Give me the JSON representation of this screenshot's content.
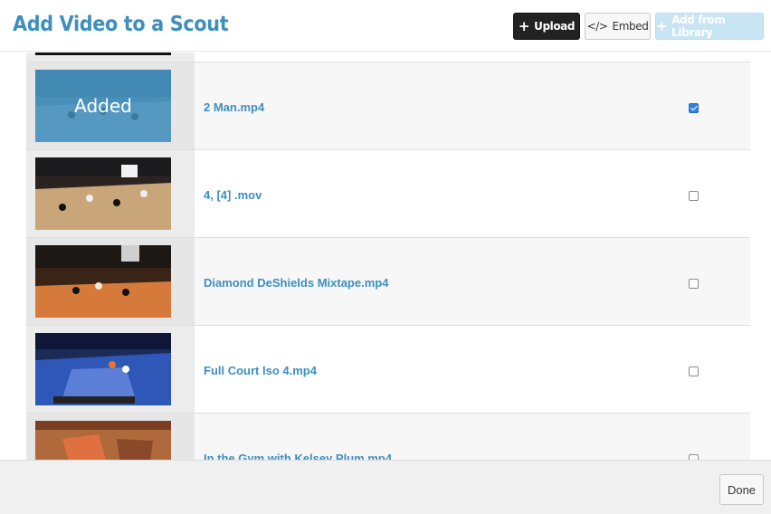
{
  "header": {
    "title": "Add Video to a Scout",
    "upload_label": "Upload",
    "embed_label": "Embed",
    "library_label": "Add from Library"
  },
  "videos": [
    {
      "name": "2 Man.mp4",
      "checked": true,
      "overlay": "Added"
    },
    {
      "name": "4, [4] .mov",
      "checked": false
    },
    {
      "name": "Diamond DeShields Mixtape.mp4",
      "checked": false
    },
    {
      "name": "Full Court Iso 4.mp4",
      "checked": false
    },
    {
      "name": "In the Gym with Kelsey Plum.mp4",
      "checked": false
    }
  ],
  "footer": {
    "done_label": "Done"
  },
  "colors": {
    "accent": "#3d8fbf",
    "checkbox_checked": "#2f7fe0"
  }
}
